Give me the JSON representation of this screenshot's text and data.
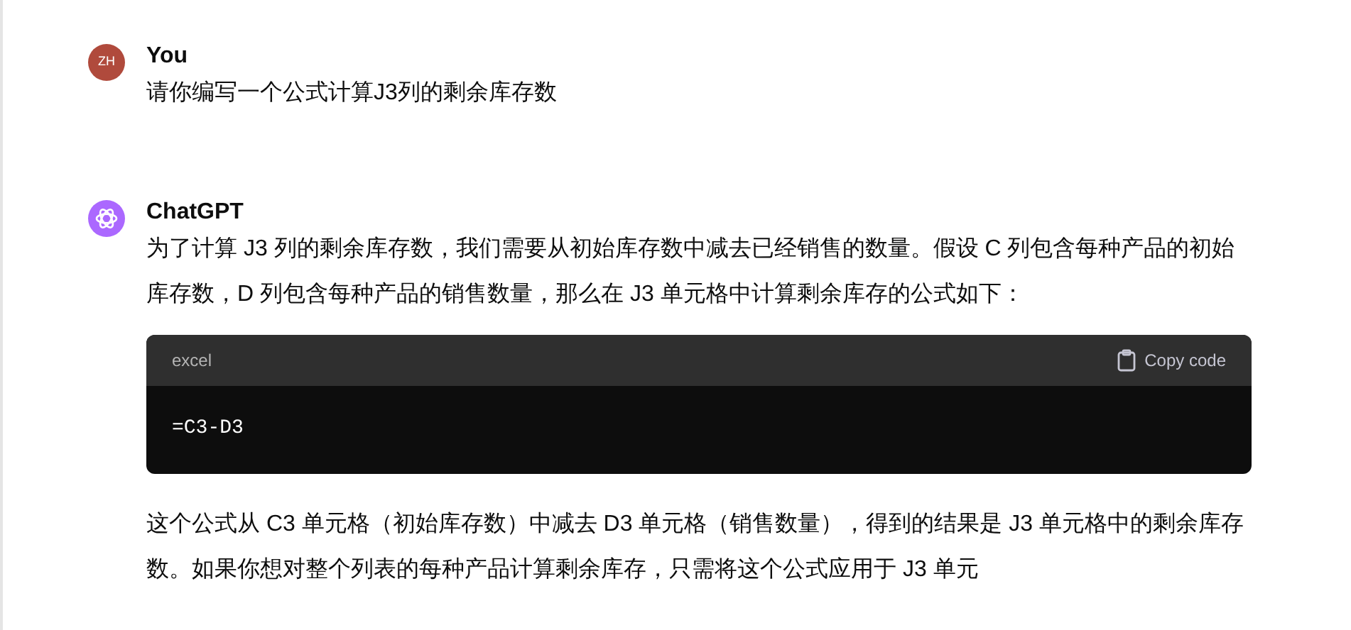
{
  "messages": [
    {
      "kind": "user",
      "avatar": "ZH",
      "author": "You",
      "text": "请你编写一个公式计算J3列的剩余库存数"
    },
    {
      "kind": "assistant",
      "author": "ChatGPT",
      "paragraphs": [
        "为了计算 J3 列的剩余库存数，我们需要从初始库存数中减去已经销售的数量。假设 C 列包含每种产品的初始库存数，D 列包含每种产品的销售数量，那么在 J3 单元格中计算剩余库存的公式如下："
      ],
      "code": {
        "language": "excel",
        "copy_label": "Copy code",
        "code": "=C3-D3"
      },
      "after": [
        "这个公式从 C3 单元格（初始库存数）中减去 D3 单元格（销售数量），得到的结果是 J3 单元格中的剩余库存数。如果你想对整个列表的每种产品计算剩余库存，只需将这个公式应用于 J3 单元"
      ]
    }
  ]
}
